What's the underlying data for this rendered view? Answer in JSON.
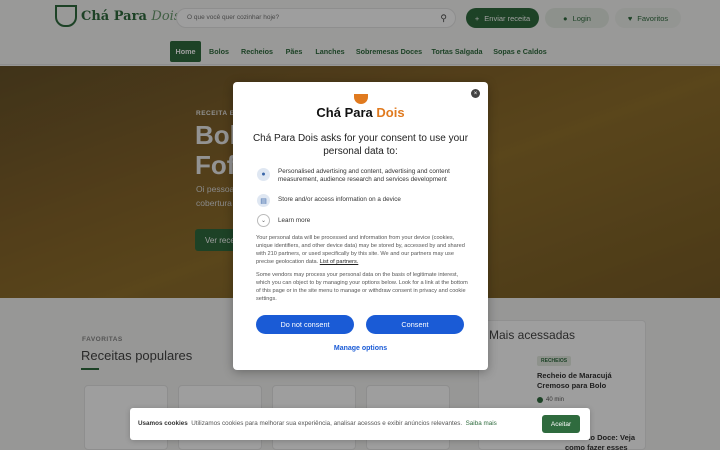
{
  "header": {
    "logo_main": "Chá Para",
    "logo_script": "Dois",
    "search_placeholder": "O que você quer cozinhar hoje?",
    "send_recipe": "Enviar receita",
    "login": "Login",
    "favorites": "Favoritos"
  },
  "nav": {
    "items": [
      "Home",
      "Bolos",
      "Recheios",
      "Pães",
      "Lanches",
      "Sobremesas Doces",
      "Tortas Salgada",
      "Sopas e Caldos"
    ]
  },
  "hero": {
    "label": "RECEITA EM",
    "title_line1": "Bol",
    "title_line2": "Fof",
    "desc_line1": "Oi pessoa",
    "desc_line2": "cobertura",
    "button": "Ver rece"
  },
  "favorites": {
    "label": "FAVORITAS",
    "title": "Receitas populares"
  },
  "sidebar": {
    "title": "Mais acessadas",
    "item1_badge": "RECHEIOS",
    "item1_title": "Recheio de Maracujá Cremoso para Bolo",
    "item1_time": "40 min",
    "item2_title": "lho Frito Doce: Veja como fazer esses"
  },
  "cookie_bar": {
    "title": "Usamos cookies",
    "text": "Utilizamos cookies para melhorar sua experiência, analisar acessos e exibir anúncios relevantes.",
    "link": "Saiba mais",
    "accept": "Aceitar"
  },
  "consent": {
    "logo_first": "Chá Para",
    "logo_second": "Dois",
    "heading": "Chá Para Dois asks for your consent to use your personal data to:",
    "purpose1": "Personalised advertising and content, advertising and content measurement, audience research and services development",
    "purpose2": "Store and/or access information on a device",
    "learn_more": "Learn more",
    "para1": "Your personal data will be processed and information from your device (cookies, unique identifiers, and other device data) may be stored by, accessed by and shared with 210 partners, or used specifically by this site. We and our partners may use precise geolocation data.",
    "para1_link": "List of partners.",
    "para2": "Some vendors may process your personal data on the basis of legitimate interest, which you can object to by managing your options below. Look for a link at the bottom of this page or in the site menu to manage or withdraw consent in privacy and cookie settings.",
    "do_not_consent": "Do not consent",
    "consent": "Consent",
    "manage": "Manage options",
    "close_symbol": "×"
  },
  "colors": {
    "brand_green": "#2f6b3e",
    "consent_blue": "#1a5bd6",
    "logo_orange": "#e07a1f"
  }
}
